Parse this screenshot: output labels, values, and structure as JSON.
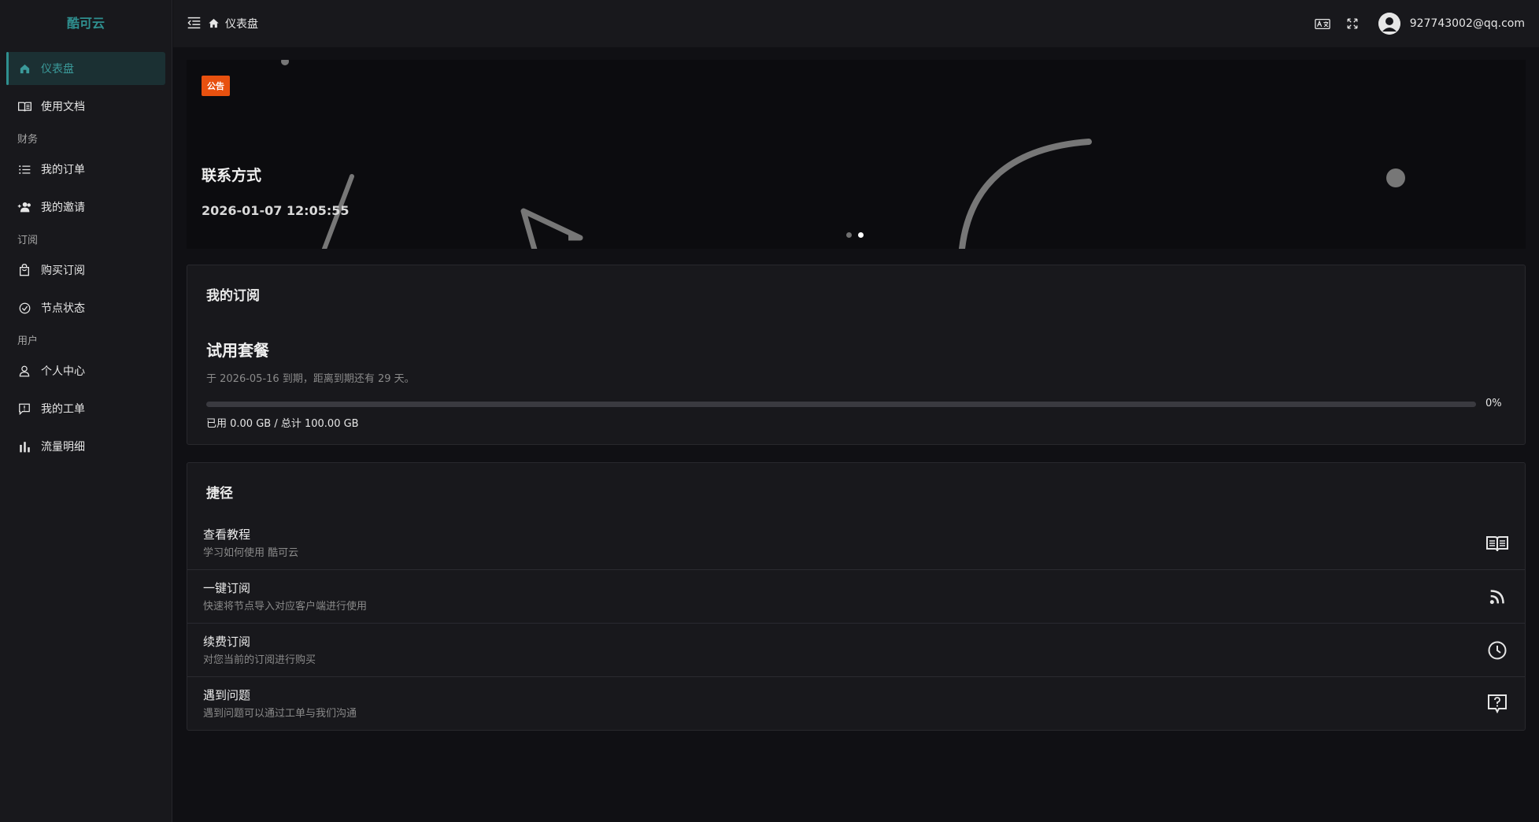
{
  "app": {
    "name": "酷可云"
  },
  "sidebar": {
    "items": [
      {
        "type": "item",
        "label": "仪表盘",
        "icon": "home-icon",
        "active": true
      },
      {
        "type": "item",
        "label": "使用文档",
        "icon": "book-icon"
      },
      {
        "type": "group",
        "label": "财务"
      },
      {
        "type": "item",
        "label": "我的订单",
        "icon": "list-icon"
      },
      {
        "type": "item",
        "label": "我的邀请",
        "icon": "user-add-icon"
      },
      {
        "type": "group",
        "label": "订阅"
      },
      {
        "type": "item",
        "label": "购买订阅",
        "icon": "bag-icon"
      },
      {
        "type": "item",
        "label": "节点状态",
        "icon": "check-circle-icon"
      },
      {
        "type": "group",
        "label": "用户"
      },
      {
        "type": "item",
        "label": "个人中心",
        "icon": "person-icon"
      },
      {
        "type": "item",
        "label": "我的工单",
        "icon": "ticket-icon"
      },
      {
        "type": "item",
        "label": "流量明细",
        "icon": "bar-chart-icon"
      }
    ]
  },
  "header": {
    "breadcrumb": "仪表盘",
    "email": "927743002@qq.com",
    "icons": [
      "collapse-menu-icon",
      "home-icon",
      "moon-icon",
      "translate-icon",
      "fullscreen-icon",
      "avatar-icon"
    ]
  },
  "banner": {
    "badge": "公告",
    "title": "联系方式",
    "date": "2026-01-07 12:05:55",
    "dots": 2,
    "active_dot": 1
  },
  "subscription": {
    "title": "我的订阅",
    "plan": "试用套餐",
    "expire_text": "于 2026-05-16 到期，距离到期还有 29 天。",
    "percent_label": "0%",
    "percent": 0,
    "usage_text": "已用 0.00 GB / 总计 100.00 GB"
  },
  "shortcuts": {
    "title": "捷径",
    "items": [
      {
        "name": "查看教程",
        "desc": "学习如何使用 酷可云",
        "icon": "book-open-icon"
      },
      {
        "name": "一键订阅",
        "desc": "快速将节点导入对应客户端进行使用",
        "icon": "rss-icon"
      },
      {
        "name": "续费订阅",
        "desc": "对您当前的订阅进行购买",
        "icon": "clock-icon"
      },
      {
        "name": "遇到问题",
        "desc": "遇到问题可以通过工单与我们沟通",
        "icon": "help-chat-icon"
      }
    ]
  },
  "colors": {
    "accent": "#2f8f8f",
    "badge": "#e8510f",
    "background": "#101014",
    "panel": "#18181c"
  }
}
